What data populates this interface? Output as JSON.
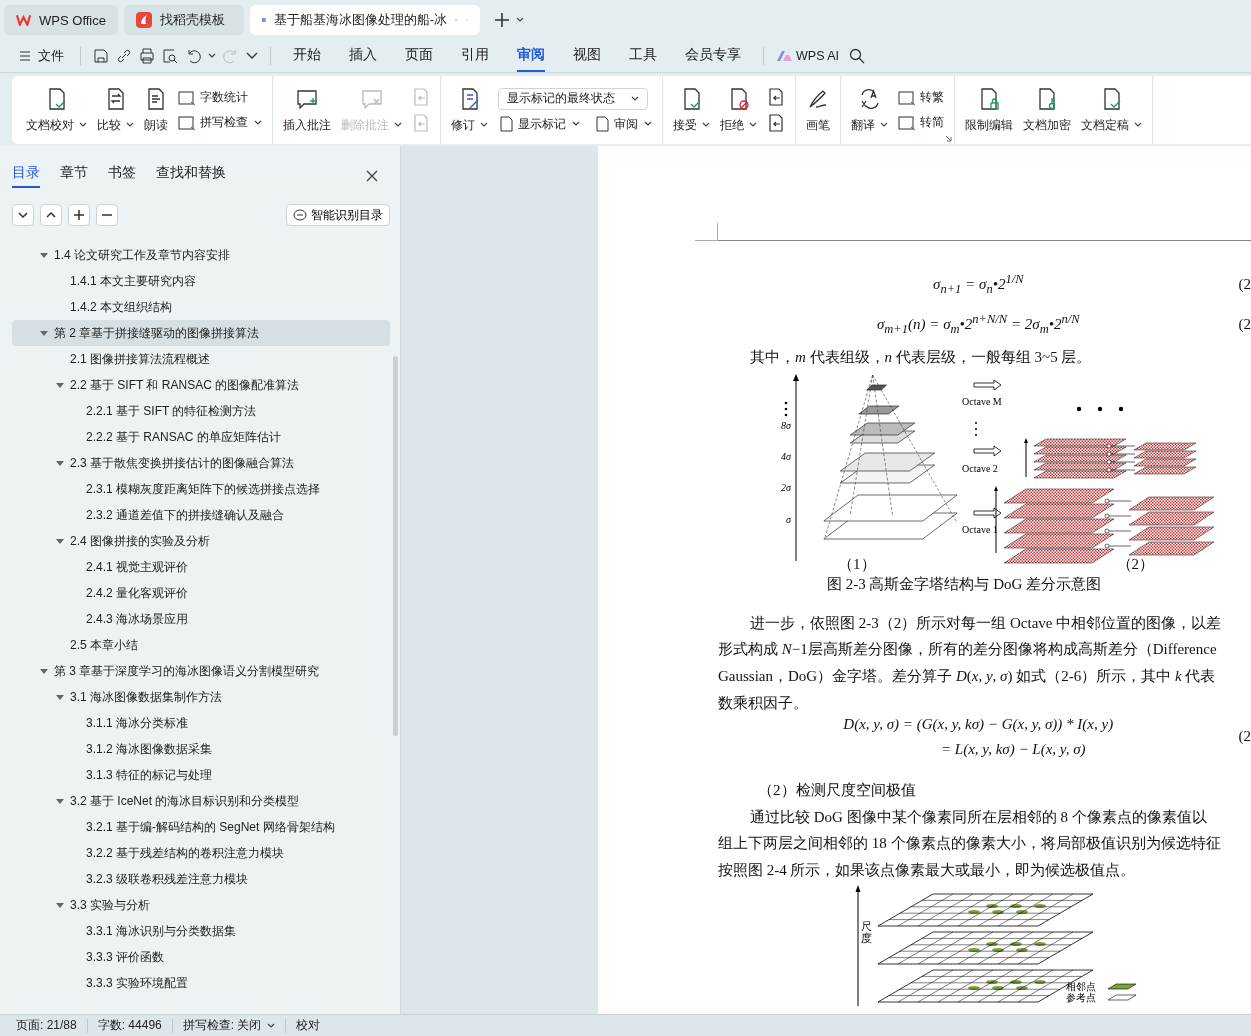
{
  "browser_tabs": [
    {
      "label": "WPS Office",
      "kind": "wps",
      "selected": false
    },
    {
      "label": "找稻壳模板",
      "kind": "docer",
      "selected": false
    },
    {
      "label": "基于船基海冰图像处理的船-冰",
      "kind": "doc",
      "selected": true
    }
  ],
  "menu": {
    "file": "文件",
    "tabs": [
      {
        "label": "开始",
        "selected": false
      },
      {
        "label": "插入",
        "selected": false
      },
      {
        "label": "页面",
        "selected": false
      },
      {
        "label": "引用",
        "selected": false
      },
      {
        "label": "审阅",
        "selected": true
      },
      {
        "label": "视图",
        "selected": false
      },
      {
        "label": "工具",
        "selected": false
      },
      {
        "label": "会员专享",
        "selected": false
      }
    ],
    "ai": "WPS AI"
  },
  "ribbon": {
    "groups": [
      {
        "columns": [
          {
            "kind": "big",
            "label": "文档校对",
            "dropdown": true,
            "disabled": false
          },
          {
            "kind": "big",
            "label": "比较",
            "dropdown": true,
            "disabled": false
          },
          {
            "kind": "big",
            "label": "朗读",
            "dropdown": false,
            "disabled": false
          },
          {
            "kind": "stack",
            "items": [
              {
                "kind": "text",
                "label": "字数统计",
                "dropdown": false,
                "disabled": false
              },
              {
                "kind": "text",
                "label": "拼写检查",
                "dropdown": true,
                "disabled": false
              }
            ]
          }
        ]
      },
      {
        "columns": [
          {
            "kind": "big",
            "label": "插入批注",
            "dropdown": false,
            "disabled": false
          },
          {
            "kind": "big",
            "label": "删除批注",
            "dropdown": true,
            "disabled": true
          },
          {
            "kind": "stack",
            "items": [
              {
                "kind": "icon",
                "disabled": true
              },
              {
                "kind": "icon",
                "disabled": true
              }
            ]
          }
        ]
      },
      {
        "columns": [
          {
            "kind": "big",
            "label": "修订",
            "dropdown": true,
            "disabled": false
          },
          {
            "kind": "panel",
            "select": "显示标记的最终状态",
            "items": [
              {
                "label": "显示标记",
                "dropdown": true,
                "disabled": false
              },
              {
                "label": "审阅",
                "dropdown": true,
                "disabled": false
              }
            ]
          }
        ]
      },
      {
        "columns": [
          {
            "kind": "big",
            "label": "接受",
            "dropdown": true,
            "disabled": false
          },
          {
            "kind": "big",
            "label": "拒绝",
            "dropdown": true,
            "disabled": false
          },
          {
            "kind": "stack",
            "items": [
              {
                "kind": "icon",
                "disabled": false
              },
              {
                "kind": "icon",
                "disabled": false
              }
            ]
          }
        ]
      },
      {
        "columns": [
          {
            "kind": "big",
            "label": "画笔",
            "dropdown": false,
            "disabled": false
          }
        ]
      },
      {
        "launcher": true,
        "columns": [
          {
            "kind": "big",
            "label": "翻译",
            "dropdown": true,
            "disabled": false
          },
          {
            "kind": "stack",
            "items": [
              {
                "kind": "text",
                "label": "转繁",
                "dropdown": false,
                "disabled": false
              },
              {
                "kind": "text",
                "label": "转简",
                "dropdown": false,
                "disabled": false
              }
            ]
          }
        ]
      },
      {
        "columns": [
          {
            "kind": "big",
            "label": "限制编辑",
            "dropdown": false,
            "disabled": false
          },
          {
            "kind": "big",
            "label": "文档加密",
            "dropdown": false,
            "disabled": false
          },
          {
            "kind": "big",
            "label": "文档定稿",
            "dropdown": true,
            "disabled": false
          }
        ]
      }
    ]
  },
  "sidebar": {
    "tabs": [
      {
        "label": "目录",
        "selected": true
      },
      {
        "label": "章节",
        "selected": false
      },
      {
        "label": "书签",
        "selected": false
      },
      {
        "label": "查找和替换",
        "selected": false
      }
    ],
    "smart_button": "智能识别目录",
    "toc": [
      {
        "label": "1.4  论文研究工作及章节内容安排",
        "selected": false,
        "expanded": true,
        "children": [
          {
            "label": "1.4.1  本文主要研究内容",
            "selected": false
          },
          {
            "label": "1.4.2  本文组织结构",
            "selected": false
          }
        ]
      },
      {
        "label": "第 2 章基于拼接缝驱动的图像拼接算法",
        "selected": true,
        "expanded": true,
        "children": [
          {
            "label": "2.1  图像拼接算法流程概述",
            "selected": false
          },
          {
            "label": "2.2  基于 SIFT 和 RANSAC 的图像配准算法",
            "selected": false,
            "expanded": true,
            "children": [
              {
                "label": "2.2.1  基于 SIFT 的特征检测方法",
                "selected": false
              },
              {
                "label": "2.2.2  基于 RANSAC 的单应矩阵估计",
                "selected": false
              }
            ]
          },
          {
            "label": "2.3  基于散焦变换拼接估计的图像融合算法",
            "selected": false,
            "expanded": true,
            "children": [
              {
                "label": "2.3.1  模糊灰度距离矩阵下的候选拼接点选择",
                "selected": false
              },
              {
                "label": "2.3.2  通道差值下的拼接缝确认及融合",
                "selected": false
              }
            ]
          },
          {
            "label": "2.4  图像拼接的实验及分析",
            "selected": false,
            "expanded": true,
            "children": [
              {
                "label": "2.4.1  视觉主观评价",
                "selected": false
              },
              {
                "label": "2.4.2  量化客观评价",
                "selected": false
              },
              {
                "label": "2.4.3  海冰场景应用",
                "selected": false
              }
            ]
          },
          {
            "label": "2.5  本章小结",
            "selected": false
          }
        ]
      },
      {
        "label": "第 3 章基于深度学习的海冰图像语义分割模型研究",
        "selected": false,
        "expanded": true,
        "children": [
          {
            "label": "3.1  海冰图像数据集制作方法",
            "selected": false,
            "expanded": true,
            "children": [
              {
                "label": "3.1.1  海冰分类标准",
                "selected": false
              },
              {
                "label": "3.1.2  海冰图像数据采集",
                "selected": false
              },
              {
                "label": "3.1.3  特征的标记与处理",
                "selected": false
              }
            ]
          },
          {
            "label": "3.2  基于 IceNet 的海冰目标识别和分类模型",
            "selected": false,
            "expanded": true,
            "children": [
              {
                "label": "3.2.1  基于编-解码结构的 SegNet 网络骨架结构",
                "selected": false
              },
              {
                "label": "3.2.2  基于残差结构的卷积注意力模块",
                "selected": false
              },
              {
                "label": "3.2.3  级联卷积残差注意力模块",
                "selected": false
              }
            ]
          },
          {
            "label": "3.3  实验与分析",
            "selected": false,
            "expanded": true,
            "children": [
              {
                "label": "3.3.1  海冰识别与分类数据集",
                "selected": false
              },
              {
                "label": "3.3.3  评价函数",
                "selected": false
              },
              {
                "label": "3.3.3  实验环境配置",
                "selected": false
              }
            ]
          }
        ]
      }
    ]
  },
  "document": {
    "blocks": [
      {
        "kind": "equation",
        "lines": [
          "σ$_{n+1}$ = σ$_{n}$•2$^{1/N}$"
        ],
        "number": "(2"
      },
      {
        "kind": "equation",
        "lines": [
          "σ$_{m+1}$(n) = σ$_{m}$•2$^{n+N/N}$ = 2σ$_{m}$•2$^{n/N}$"
        ],
        "number": "(2"
      },
      {
        "kind": "paragraph",
        "lines": [
          "其中，*m* 代表组级，*n* 代表层级，一般每组 3~5 层。"
        ]
      },
      {
        "kind": "figure_pyramid",
        "axis_labels": [
          "8σ",
          "4σ",
          "2σ",
          "σ"
        ],
        "octaves": [
          "Octave M",
          "Octave 2",
          "Octave 1"
        ],
        "sub_captions": [
          "（1）",
          "（2）"
        ],
        "caption": "图 2-3  高斯金字塔结构与 DoG 差分示意图"
      },
      {
        "kind": "paragraph",
        "lines": [
          "进一步，依照图 2-3（2）所示对每一组 Octave 中相邻位置的图像，以差",
          "形式构成 *N*−1层高斯差分图像，所有的差分图像将构成高斯差分（Difference",
          "Gaussian，DoG）金字塔。差分算子 *D*(*x*, *y*, *σ*) 如式（2-6）所示，其中 *k* 代表",
          "数乘积因子。"
        ]
      },
      {
        "kind": "equation",
        "lines": [
          "D(x, y, σ) = (G(x, y, kσ) − G(x, y, σ)) * I(x, y)",
          "= L(x, y, kσ) − L(x, y, σ)"
        ],
        "number": "(2"
      },
      {
        "kind": "heading",
        "text": "（2）检测尺度空间极值"
      },
      {
        "kind": "paragraph",
        "lines": [
          "通过比较 DoG 图像中某个像素同所在层相邻的 8 个像素点的像素值以",
          "组上下两层之间相邻的 18 个像素点的像素大小，将局部极值识别为候选特征",
          "按照图 2-4 所示，如果该点像素最大或最小，即为候选极值点。"
        ]
      },
      {
        "kind": "figure_grid",
        "axis_label": "尺度",
        "legend": [
          "相邻点",
          "参考点"
        ]
      }
    ]
  },
  "status_bar": {
    "page": "页面: 21/88",
    "words": "字数: 44496",
    "spell": "拼写检查: 关闭",
    "proof": "校对"
  }
}
